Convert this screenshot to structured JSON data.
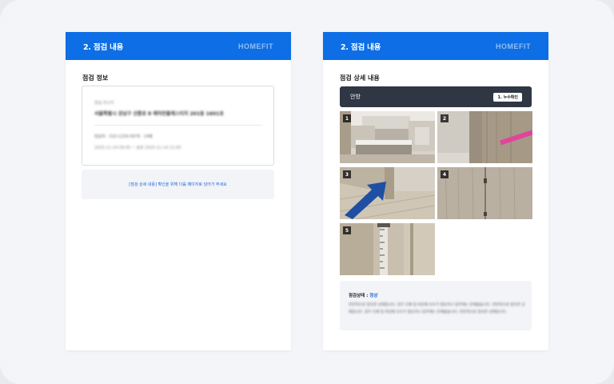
{
  "left_page": {
    "header_title": "2. 점검 내용",
    "brand": "HOMEFIT",
    "section_title": "점검 정보",
    "info": {
      "address_label": "점검 주소지",
      "address_value": "서울특별시 강남구 선릉로 8 래미안블레스티지 201동 1601호",
      "meta_line_1": "점검자 · 010-1234-5678 · 24평",
      "meta_line_2": "2025-11-14 09:00 ~ 종료 2025-11-14 11:00"
    },
    "notice": "[점검 상세 내용] 확인을 위해 다음 페이지로 넘어가 주세요"
  },
  "right_page": {
    "header_title": "2. 점검 내용",
    "brand": "HOMEFIT",
    "section_title": "점검 상세 내용",
    "room": {
      "name": "안방",
      "badge": "1. 누수확인"
    },
    "photos": [
      {
        "number": "1",
        "subject": "kitchen-photo"
      },
      {
        "number": "2",
        "subject": "door-frame-photo"
      },
      {
        "number": "3",
        "subject": "floor-arrow-photo"
      },
      {
        "number": "4",
        "subject": "wood-panel-photo"
      },
      {
        "number": "5",
        "subject": "tape-measure-photo"
      }
    ],
    "status": {
      "label": "점검상태 :",
      "value": "정상",
      "description": "전반적으로 양호한 상태입니다. 일부 도배 및 마감재 보수가 필요하나 입주에는 문제없습니다. 전반적으로 양호한 상태입니다. 일부 도배 및 마감재 보수가 필요하나 입주에는 문제없습니다. 전반적으로 양호한 상태입니다."
    }
  },
  "colors": {
    "header_blue": "#0d6ee6",
    "room_bar": "#2f3644",
    "status_blue": "#1b63d6"
  }
}
